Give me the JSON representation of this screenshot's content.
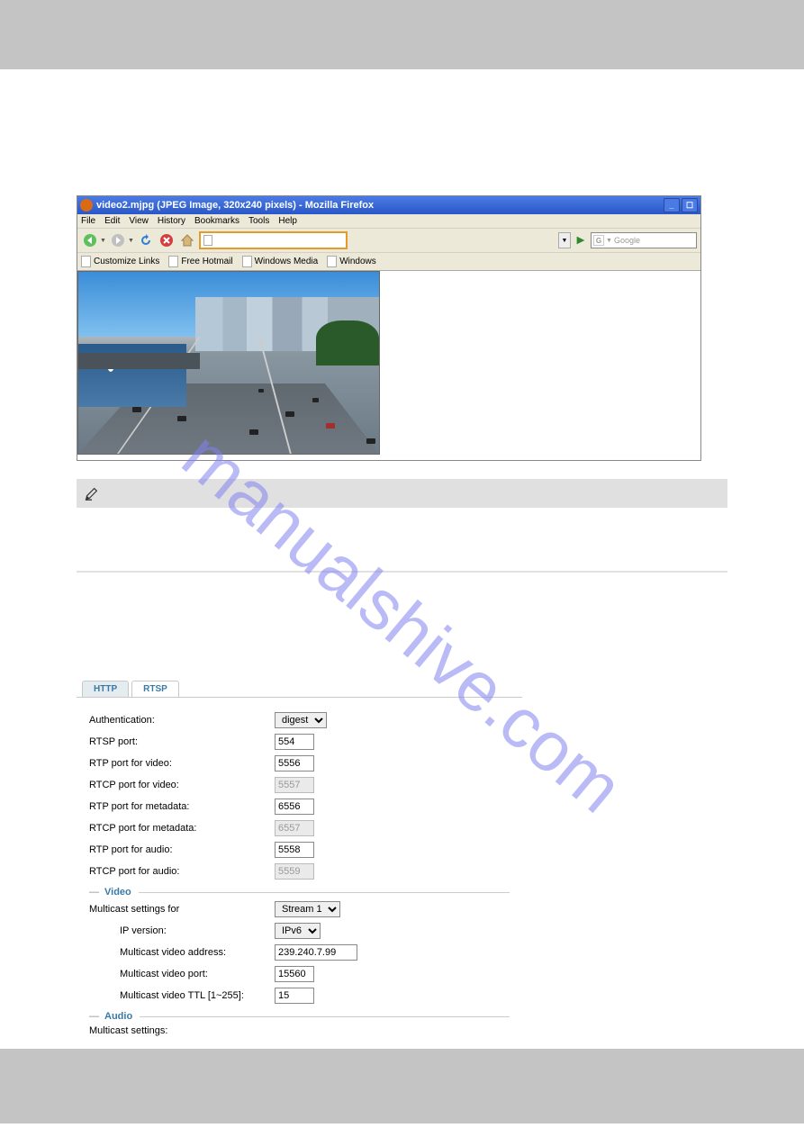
{
  "watermark": "manualshive.com",
  "browser": {
    "title": "video2.mjpg (JPEG Image, 320x240 pixels) - Mozilla Firefox",
    "menubar": [
      "File",
      "Edit",
      "View",
      "History",
      "Bookmarks",
      "Tools",
      "Help"
    ],
    "url": "",
    "search_engine": "G",
    "search_placeholder": "Google",
    "bookmarks": [
      "Customize Links",
      "Free Hotmail",
      "Windows Media",
      "Windows"
    ]
  },
  "settings": {
    "tabs": {
      "http": "HTTP",
      "rtsp": "RTSP"
    },
    "rows": {
      "auth_label": "Authentication:",
      "auth_value": "digest",
      "rtsp_port_label": "RTSP port:",
      "rtsp_port_value": "554",
      "rtp_video_label": "RTP port for video:",
      "rtp_video_value": "5556",
      "rtcp_video_label": "RTCP port for video:",
      "rtcp_video_value": "5557",
      "rtp_meta_label": "RTP port for metadata:",
      "rtp_meta_value": "6556",
      "rtcp_meta_label": "RTCP port for metadata:",
      "rtcp_meta_value": "6557",
      "rtp_audio_label": "RTP port for audio:",
      "rtp_audio_value": "5558",
      "rtcp_audio_label": "RTCP port for audio:",
      "rtcp_audio_value": "5559"
    },
    "video_section": {
      "title": "Video",
      "mcast_for_label": "Multicast settings for",
      "mcast_for_value": "Stream 1",
      "ipver_label": "IP version:",
      "ipver_value": "IPv6",
      "mvaddr_label": "Multicast video address:",
      "mvaddr_value": "239.240.7.99",
      "mvport_label": "Multicast video port:",
      "mvport_value": "15560",
      "mvttl_label": "Multicast video TTL [1~255]:",
      "mvttl_value": "15"
    },
    "audio_section": {
      "title": "Audio",
      "mcast_label": "Multicast settings:"
    }
  }
}
